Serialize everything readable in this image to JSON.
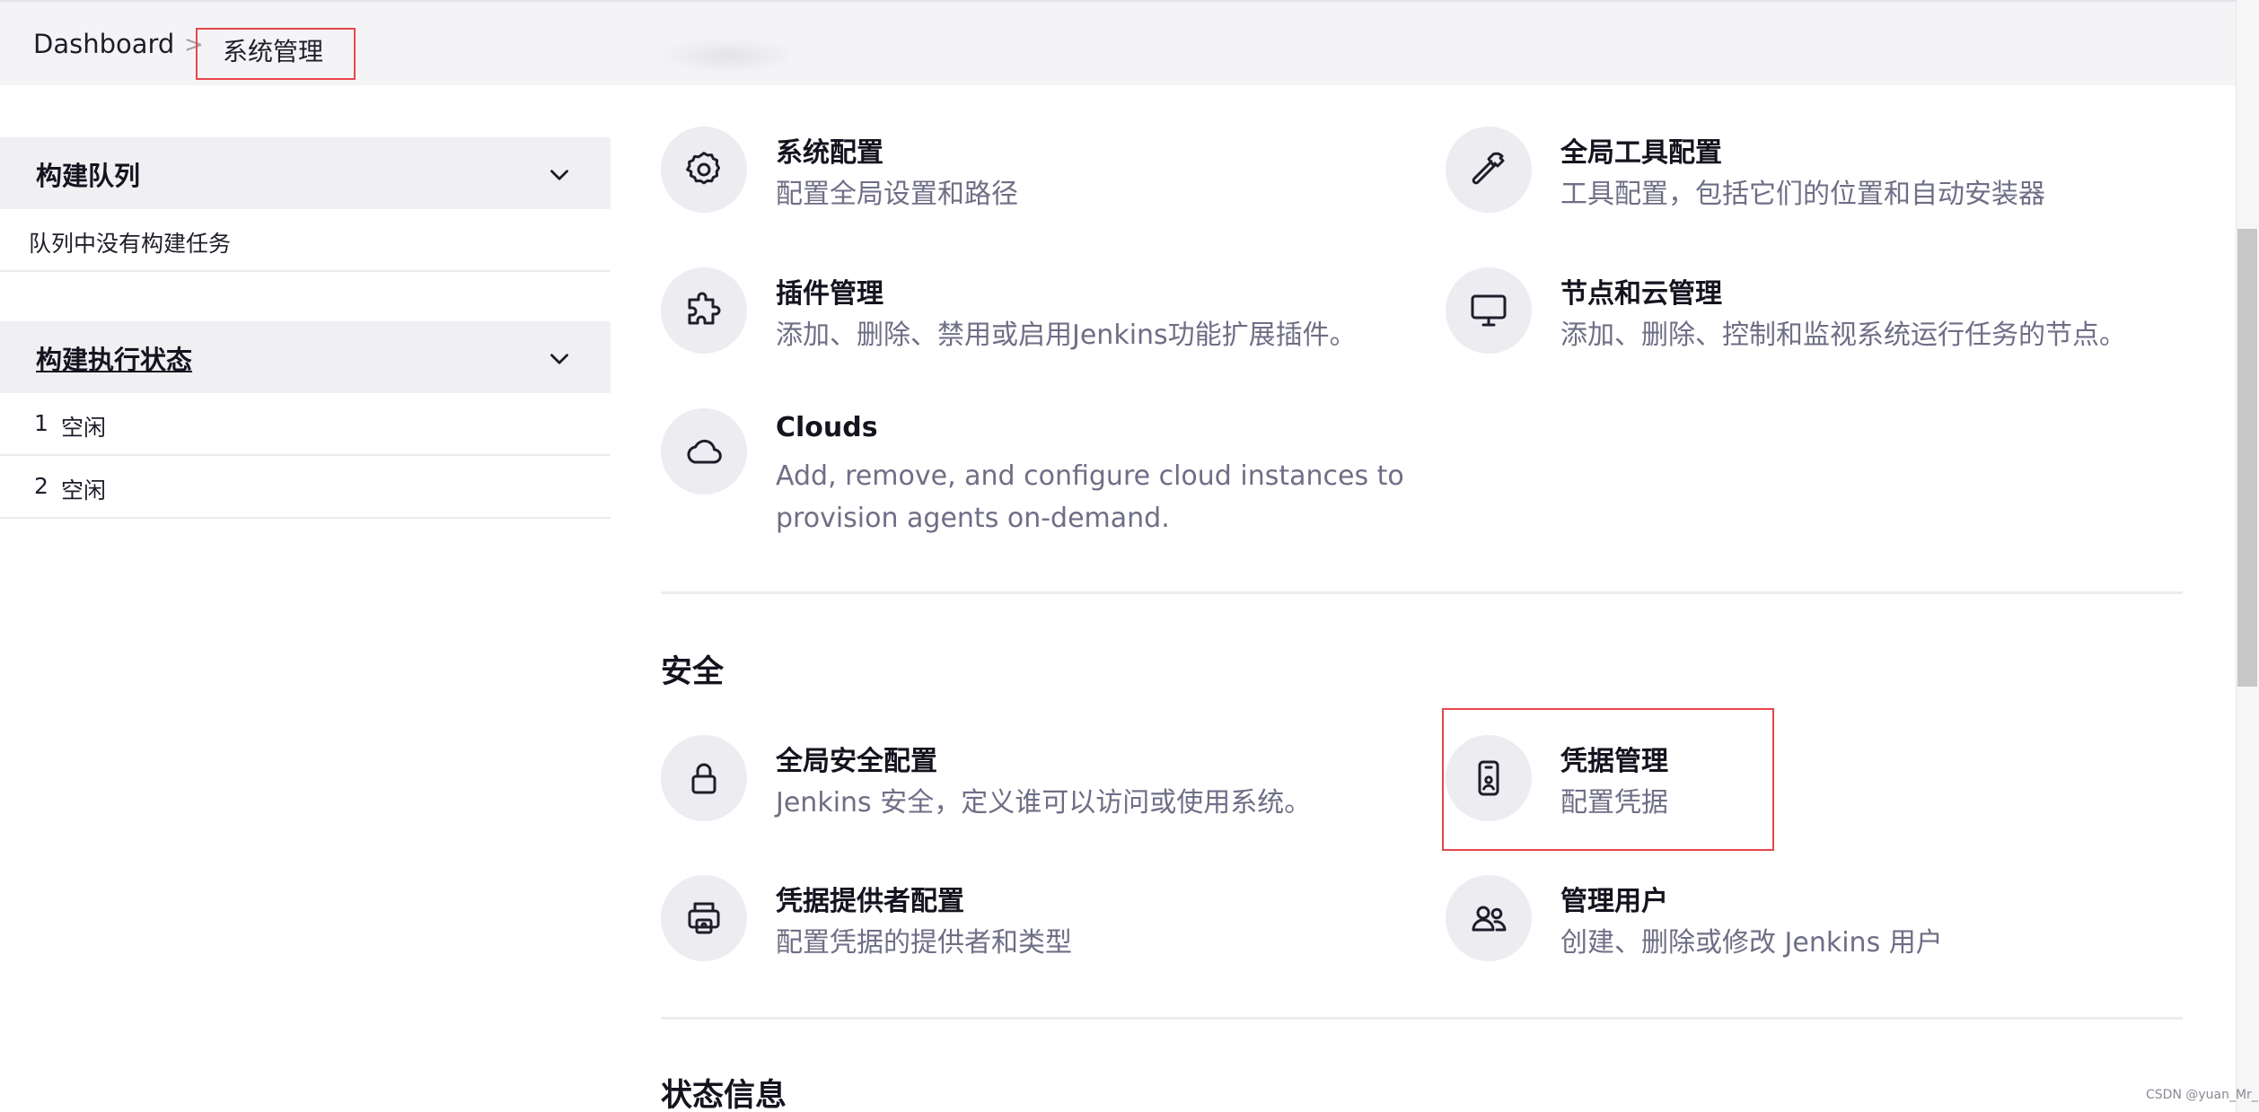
{
  "breadcrumb": {
    "home": "Dashboard",
    "separator": ">",
    "current": "系统管理"
  },
  "sidebar": {
    "queue": {
      "title": "构建队列",
      "empty": "队列中没有构建任务"
    },
    "executors": {
      "title": "构建执行状态",
      "items": [
        {
          "num": "1",
          "status": "空闲"
        },
        {
          "num": "2",
          "status": "空闲"
        }
      ]
    }
  },
  "system": {
    "items": [
      {
        "name": "系统配置",
        "desc": "配置全局设置和路径",
        "icon": "gear-icon"
      },
      {
        "name": "全局工具配置",
        "desc": "工具配置，包括它们的位置和自动安装器",
        "icon": "hammer-icon"
      },
      {
        "name": "插件管理",
        "desc": "添加、删除、禁用或启用Jenkins功能扩展插件。",
        "icon": "puzzle-icon"
      },
      {
        "name": "节点和云管理",
        "desc": "添加、删除、控制和监视系统运行任务的节点。",
        "icon": "monitor-icon"
      },
      {
        "name": "Clouds",
        "desc_line1": "Add, remove, and configure cloud instances to",
        "desc_line2": "provision agents on-demand.",
        "icon": "cloud-icon"
      }
    ]
  },
  "security": {
    "title": "安全",
    "items": [
      {
        "name": "全局安全配置",
        "desc": "Jenkins 安全，定义谁可以访问或使用系统。",
        "icon": "lock-icon"
      },
      {
        "name": "凭据管理",
        "desc": "配置凭据",
        "icon": "id-card-icon"
      },
      {
        "name": "凭据提供者配置",
        "desc": "配置凭据的提供者和类型",
        "icon": "credential-provider-icon"
      },
      {
        "name": "管理用户",
        "desc": "创建、删除或修改 Jenkins 用户",
        "icon": "users-icon"
      }
    ]
  },
  "status": {
    "title": "状态信息"
  },
  "watermark": "CSDN @yuan_Mr_",
  "colors": {
    "highlight": "#e8464b",
    "icon_bg": "#ececf1",
    "desc": "#6e6e86"
  }
}
